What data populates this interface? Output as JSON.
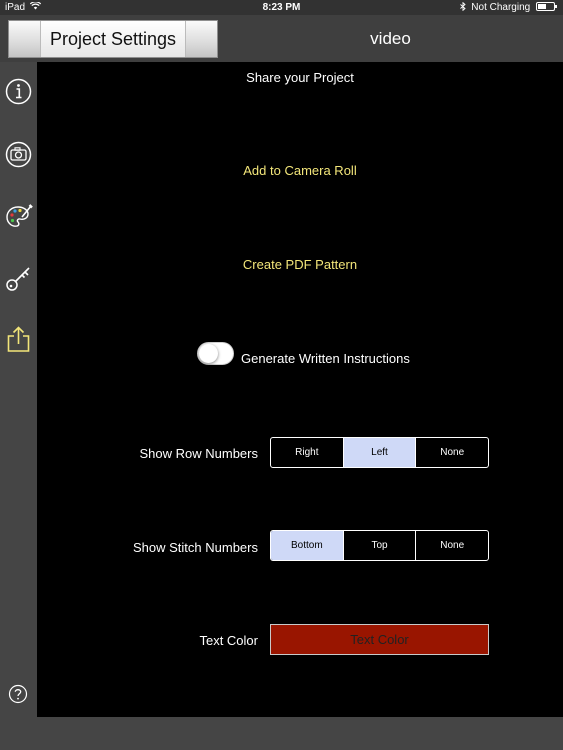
{
  "status_bar": {
    "device": "iPad",
    "time": "8:23 PM",
    "charging": "Not Charging"
  },
  "navbar": {
    "back_label": "Project Settings",
    "title": "video"
  },
  "sidebar": {
    "items": [
      {
        "icon": "info-icon"
      },
      {
        "icon": "camera-icon"
      },
      {
        "icon": "palette-icon"
      },
      {
        "icon": "key-icon"
      },
      {
        "icon": "share-icon",
        "active": true
      }
    ],
    "help_icon": "help-icon"
  },
  "share": {
    "heading": "Share your Project",
    "add_camera_roll": "Add to Camera Roll",
    "create_pdf": "Create PDF Pattern",
    "generate_label": "Generate Written Instructions",
    "generate_on": false
  },
  "row_numbers": {
    "label": "Show Row Numbers",
    "options": [
      "Right",
      "Left",
      "None"
    ],
    "selected": "Left"
  },
  "stitch_numbers": {
    "label": "Show Stitch Numbers",
    "options": [
      "Bottom",
      "Top",
      "None"
    ],
    "selected": "Bottom"
  },
  "text_color": {
    "label": "Text Color",
    "button_label": "Text Color",
    "color": "#991500"
  },
  "colors": {
    "accent_yellow": "#f3e67a",
    "selected_segment": "#cfd9f7",
    "background": "#000000",
    "chrome": "#454545"
  }
}
